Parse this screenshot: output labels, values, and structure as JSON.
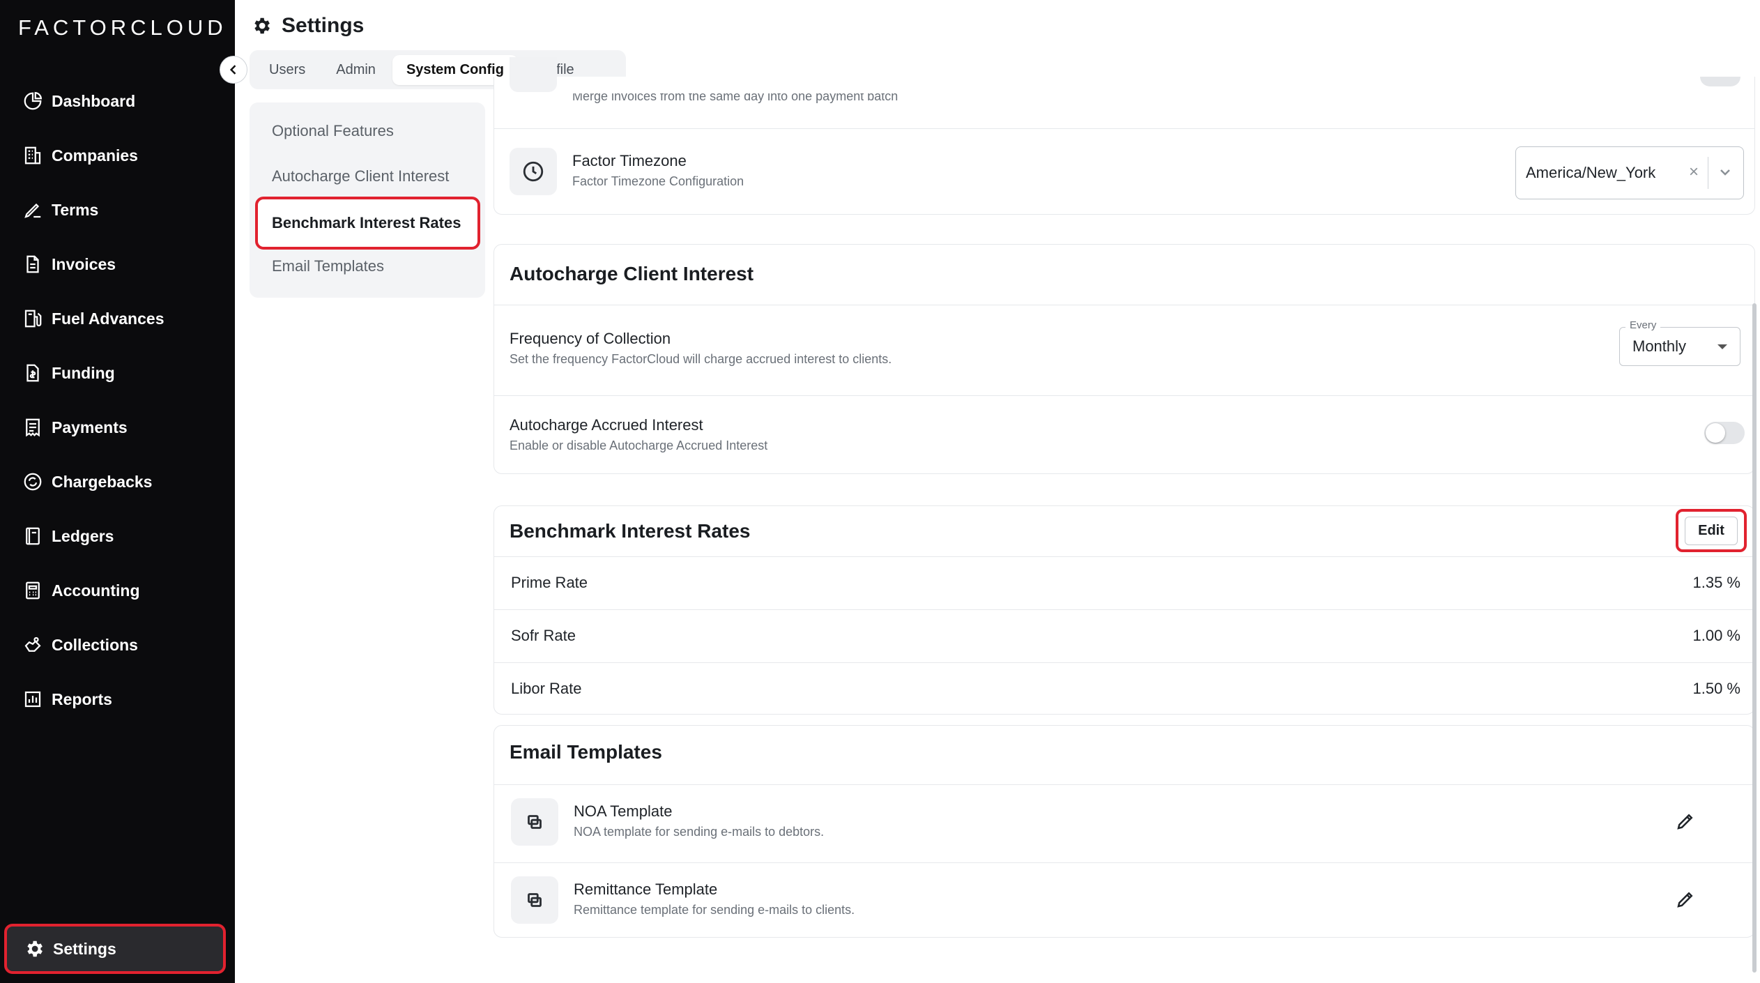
{
  "brand": "FACTORCLOUD",
  "sidebar": {
    "items": [
      {
        "label": "Dashboard",
        "icon": "pie-chart-icon"
      },
      {
        "label": "Companies",
        "icon": "building-icon"
      },
      {
        "label": "Terms",
        "icon": "signature-icon"
      },
      {
        "label": "Invoices",
        "icon": "document-icon"
      },
      {
        "label": "Fuel Advances",
        "icon": "fuel-icon"
      },
      {
        "label": "Funding",
        "icon": "money-document-icon"
      },
      {
        "label": "Payments",
        "icon": "receipt-icon"
      },
      {
        "label": "Chargebacks",
        "icon": "refresh-icon"
      },
      {
        "label": "Ledgers",
        "icon": "book-icon"
      },
      {
        "label": "Accounting",
        "icon": "calculator-icon"
      },
      {
        "label": "Collections",
        "icon": "hand-coin-icon"
      },
      {
        "label": "Reports",
        "icon": "bar-chart-icon"
      }
    ],
    "settings_label": "Settings"
  },
  "header": {
    "title": "Settings",
    "tabs": [
      "Users",
      "Admin",
      "System Config",
      "Profile"
    ]
  },
  "subnav": {
    "items": [
      "Optional Features",
      "Autocharge Client Interest",
      "Benchmark Interest Rates",
      "Email Templates"
    ]
  },
  "optional": {
    "merge_sub": "Merge invoices from the same day into one payment batch",
    "timezone_title": "Factor Timezone",
    "timezone_sub": "Factor Timezone Configuration",
    "timezone_value": "America/New_York"
  },
  "autocharge": {
    "heading": "Autocharge Client Interest",
    "frequency_title": "Frequency of Collection",
    "frequency_sub": "Set the frequency FactorCloud will charge accrued interest to clients.",
    "frequency_label": "Every",
    "frequency_value": "Monthly",
    "accrued_title": "Autocharge Accrued Interest",
    "accrued_sub": "Enable or disable Autocharge Accrued Interest"
  },
  "benchmark": {
    "heading": "Benchmark Interest Rates",
    "edit_label": "Edit",
    "rates": [
      {
        "name": "Prime Rate",
        "value": "1.35 %"
      },
      {
        "name": "Sofr Rate",
        "value": "1.00 %"
      },
      {
        "name": "Libor Rate",
        "value": "1.50 %"
      }
    ]
  },
  "email": {
    "heading": "Email Templates",
    "templates": [
      {
        "title": "NOA Template",
        "sub": "NOA template for sending e-mails to debtors."
      },
      {
        "title": "Remittance Template",
        "sub": "Remittance template for sending e-mails to clients."
      }
    ]
  }
}
